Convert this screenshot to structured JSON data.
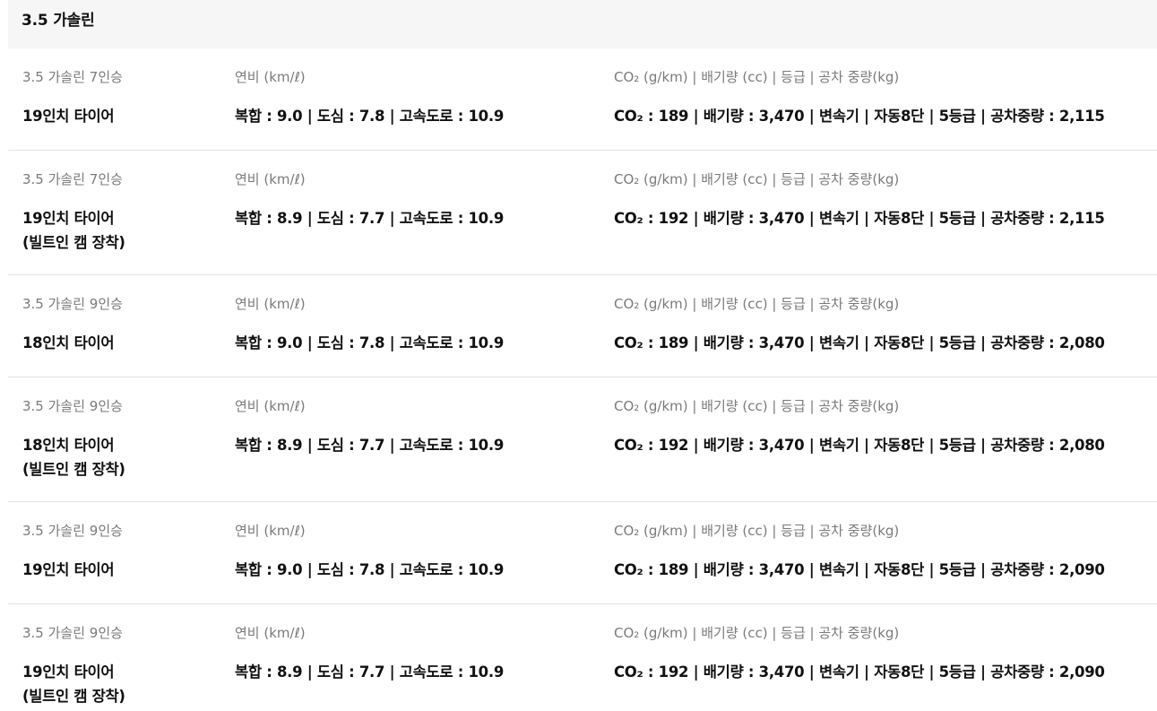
{
  "section": {
    "title": "3.5 가솔린"
  },
  "labels": {
    "efficiency": "연비 (km/ℓ)",
    "specs": "CO₂ (g/km) | 배기량 (cc) | 등급 | 공차 중량(kg)"
  },
  "rows": [
    {
      "model": "3.5 가솔린 7인승",
      "tire": "19인치 타이어",
      "efficiency": "복합 : 9.0 | 도심 : 7.8 | 고속도로 : 10.9",
      "specs": "CO₂ : 189 | 배기량 : 3,470 | 변속기 | 자동8단 | 5등급 | 공차중량 : 2,115"
    },
    {
      "model": "3.5 가솔린 7인승",
      "tire": "19인치 타이어\n(빌트인 캠 장착)",
      "efficiency": "복합 : 8.9 | 도심 : 7.7 | 고속도로 : 10.9",
      "specs": "CO₂ : 192 | 배기량 : 3,470 | 변속기 | 자동8단 | 5등급 | 공차중량 : 2,115"
    },
    {
      "model": "3.5 가솔린 9인승",
      "tire": "18인치 타이어",
      "efficiency": "복합 : 9.0 | 도심 : 7.8 | 고속도로 : 10.9",
      "specs": "CO₂ : 189 | 배기량 : 3,470 | 변속기 | 자동8단 | 5등급 | 공차중량 : 2,080"
    },
    {
      "model": "3.5 가솔린 9인승",
      "tire": "18인치 타이어\n(빌트인 캠 장착)",
      "efficiency": "복합 : 8.9 | 도심 : 7.7 | 고속도로 : 10.9",
      "specs": "CO₂ : 192 | 배기량 : 3,470 | 변속기 | 자동8단 | 5등급 | 공차중량 : 2,080"
    },
    {
      "model": "3.5 가솔린 9인승",
      "tire": "19인치 타이어",
      "efficiency": "복합 : 9.0 | 도심 : 7.8 | 고속도로 : 10.9",
      "specs": "CO₂ : 189 | 배기량 : 3,470 | 변속기 | 자동8단 | 5등급 | 공차중량 : 2,090"
    },
    {
      "model": "3.5 가솔린 9인승",
      "tire": "19인치 타이어\n(빌트인 캠 장착)",
      "efficiency": "복합 : 8.9 | 도심 : 7.7 | 고속도로 : 10.9",
      "specs": "CO₂ : 192 | 배기량 : 3,470 | 변속기 | 자동8단 | 5등급 | 공차중량 : 2,090"
    }
  ]
}
